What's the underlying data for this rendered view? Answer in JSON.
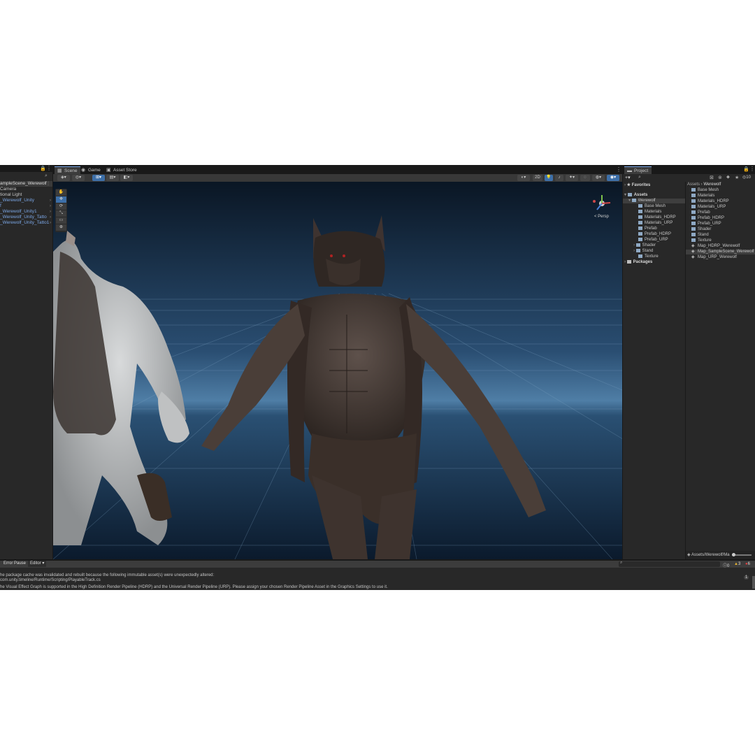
{
  "hierarchy": {
    "title_icon": "lock-icon",
    "scene_root": "ampleScene_Werewolf",
    "items": [
      {
        "label": "Camera",
        "prefab": false
      },
      {
        "label": "tional Light",
        "prefab": false
      },
      {
        "label": "_Werewolf_Unity",
        "prefab": true
      },
      {
        "label": "f",
        "prefab": true
      },
      {
        "label": "_Werewolf_Unity1",
        "prefab": true
      },
      {
        "label": "_Werewolf_Unity_Tatto",
        "prefab": true
      },
      {
        "label": "_Werewolf_Unity_Tatto1",
        "prefab": true
      }
    ]
  },
  "scene": {
    "tabs": [
      {
        "label": "Scene",
        "icon": "grid-icon",
        "active": true
      },
      {
        "label": "Game",
        "icon": "gamepad-icon",
        "active": false
      },
      {
        "label": "Asset Store",
        "icon": "store-icon",
        "active": false
      }
    ],
    "persp_label": "< Persp",
    "toolbar_2d": "2D",
    "tools": [
      "hand-tool-icon",
      "move-tool-icon",
      "rotate-tool-icon",
      "scale-tool-icon",
      "rect-tool-icon",
      "transform-tool-icon"
    ]
  },
  "project": {
    "tab": "Project",
    "hidden_count": "10",
    "favorites": "Favorites",
    "assets": "Assets",
    "packages": "Packages",
    "tree": [
      "Werewolf",
      "Base Mesh",
      "Materials",
      "Materials_HDRP",
      "Materials_URP",
      "Prefab",
      "Prefab_HDRP",
      "Prefab_URP",
      "Shader",
      "Stand",
      "Texture"
    ],
    "breadcrumb": [
      "Assets",
      "Werewolf"
    ],
    "files": [
      {
        "label": "Base Mesh",
        "type": "folder"
      },
      {
        "label": "Materials",
        "type": "folder"
      },
      {
        "label": "Materials_HDRP",
        "type": "folder"
      },
      {
        "label": "Materials_URP",
        "type": "folder"
      },
      {
        "label": "Prefab",
        "type": "folder"
      },
      {
        "label": "Prefab_HDRP",
        "type": "folder"
      },
      {
        "label": "Prefab_URP",
        "type": "folder"
      },
      {
        "label": "Shader",
        "type": "folder"
      },
      {
        "label": "Stand",
        "type": "folder"
      },
      {
        "label": "Texture",
        "type": "folder"
      },
      {
        "label": "Map_HDRP_Werewolf",
        "type": "scene"
      },
      {
        "label": "Map_SampleScene_Werewolf",
        "type": "scene"
      },
      {
        "label": "Map_URP_Werewolf",
        "type": "scene"
      }
    ],
    "status_path": "Assets/Werewolf/Ma"
  },
  "console": {
    "error_pause": "Error Pause",
    "editor": "Editor ▾",
    "messages": [
      "he package cache was invalidated and rebuilt because the following immutable asset(s) were unexpectedly altered:",
      "com.unity.timeline/Runtime/Scripting/PlayableTrack.cs",
      "he Visual Effect Graph is supported in the High Definition Render Pipeline (HDRP) and the Universal Render Pipeline (URP). Please assign your chosen Render Pipeline Asset in the Graphics Settings to use it."
    ],
    "count_info": "0",
    "count_warn": "3",
    "count_error": "6",
    "collapse_count": "1"
  }
}
